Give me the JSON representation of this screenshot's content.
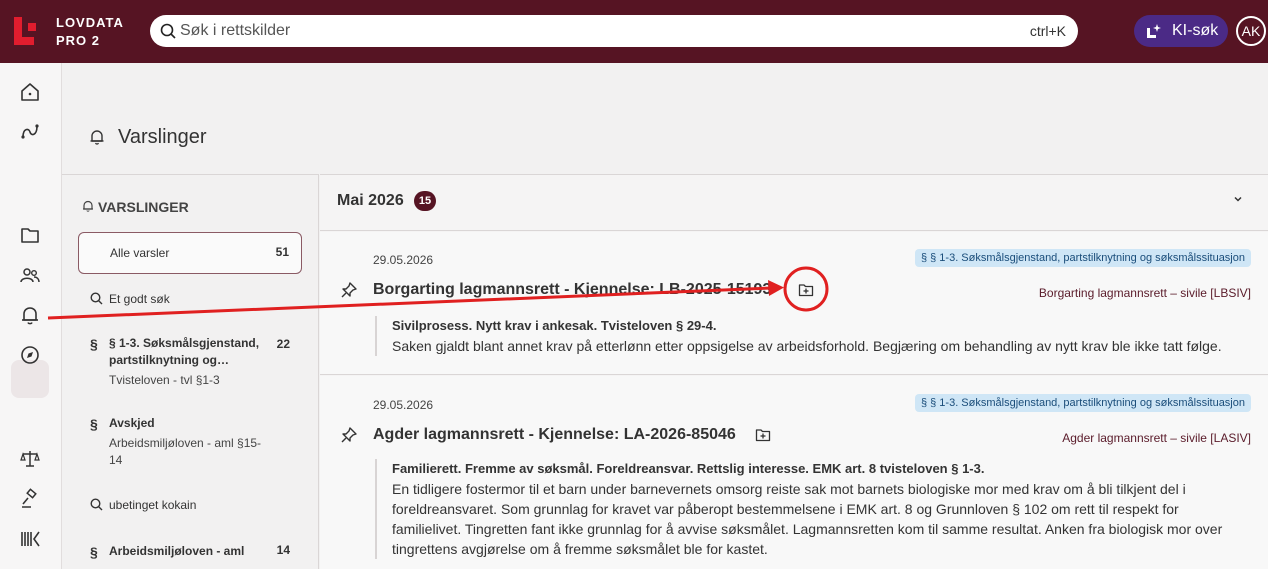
{
  "app": {
    "brand_line1": "LOVDATA",
    "brand_line2": "PRO 2"
  },
  "search": {
    "placeholder": "Søk i rettskilder",
    "shortcut": "ctrl+K"
  },
  "ki_button": {
    "label": "KI-søk"
  },
  "user": {
    "initials": "AK"
  },
  "rail": {
    "icons": [
      "home-icon",
      "route-icon",
      "folder-icon",
      "people-icon",
      "bell-icon",
      "compass-icon",
      "scales-icon",
      "gavel-icon",
      "barcode-icon"
    ],
    "active": "bell-icon"
  },
  "page": {
    "title": "Varslinger"
  },
  "sidebar": {
    "heading": "VARSLINGER",
    "all": {
      "label": "Alle varsler",
      "count": "51"
    },
    "items": [
      {
        "type": "search",
        "title": "Et godt søk"
      },
      {
        "type": "paragraph",
        "title_line1": "§ 1-3. Søksmålsgjenstand,",
        "title_line2": "partstilknytning og…",
        "subtitle": "Tvisteloven - tvl §1-3",
        "count": "22"
      },
      {
        "type": "paragraph",
        "title": "Avskjed",
        "subtitle_line1": "Arbeidsmiljøloven - aml §15-",
        "subtitle_line2": "14"
      },
      {
        "type": "search",
        "title": "ubetinget kokain"
      },
      {
        "type": "paragraph",
        "title": "Arbeidsmiljøloven - aml",
        "count": "14"
      }
    ]
  },
  "main": {
    "month": "Mai 2026",
    "month_count": "15",
    "entries": [
      {
        "date": "29.05.2026",
        "tag": "§  § 1-3. Søksmålsgjenstand, partstilknytning og søksmålssituasjon",
        "title": "Borgarting lagmannsrett - Kjennelse: LB-2025-15193",
        "court": "Borgarting lagmannsrett – sivile [LBSIV]",
        "summary_head": "Sivilprosess. Nytt krav i ankesak. Tvisteloven § 29-4.",
        "summary_body": [
          "Saken gjaldt blant annet krav på etterlønn etter oppsigelse av arbeidsforhold. Begjæring om behandling av nytt krav ble ikke tatt følge."
        ]
      },
      {
        "date": "29.05.2026",
        "tag": "§  § 1-3. Søksmålsgjenstand, partstilknytning og søksmålssituasjon",
        "title": "Agder lagmannsrett - Kjennelse: LA-2026-85046",
        "court": "Agder lagmannsrett – sivile [LASIV]",
        "summary_head": "Familierett. Fremme av søksmål. Foreldreansvar. Rettslig interesse. EMK art. 8 tvisteloven § 1-3.",
        "summary_body": [
          "En tidligere fostermor til et barn under barnevernets omsorg reiste sak mot barnets biologiske mor med krav om å bli tilkjent del i",
          "foreldreansvaret. Som grunnlag for kravet var påberopt bestemmelsene i EMK art. 8 og Grunnloven § 102 om rett til respekt for",
          "familielivet. Tingretten fant ikke grunnlag for å avvise søksmålet. Lagmannsretten kom til samme resultat. Anken fra biologisk mor over",
          "tingrettens avgjørelse om å fremme søksmålet ble for kastet."
        ]
      }
    ]
  },
  "colors": {
    "brand": "#561423",
    "ki": "#4b2a86",
    "tag_bg": "#cfe6f6",
    "annotation": "#e02020"
  }
}
